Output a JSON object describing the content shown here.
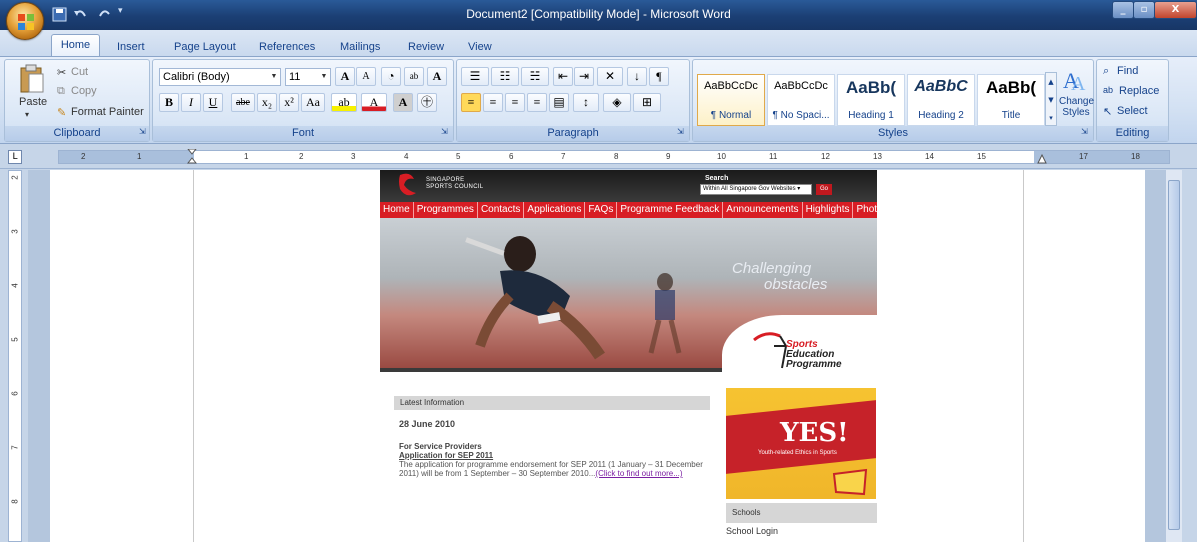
{
  "window": {
    "title": "Document2 [Compatibility Mode] - Microsoft Word",
    "close_label": "X"
  },
  "tabs": [
    "Home",
    "Insert",
    "Page Layout",
    "References",
    "Mailings",
    "Review",
    "View"
  ],
  "clipboard": {
    "paste": "Paste",
    "cut": "Cut",
    "copy": "Copy",
    "format_painter": "Format Painter",
    "label": "Clipboard"
  },
  "font": {
    "name": "Calibri (Body)",
    "size": "11",
    "bold": "B",
    "italic": "I",
    "underline": "U",
    "strikethrough": "abe",
    "subscript": "x₂",
    "superscript": "x²",
    "change_case": "Aa",
    "grow": "A",
    "shrink": "A",
    "label": "Font"
  },
  "paragraph": {
    "label": "Paragraph"
  },
  "styles": {
    "items": [
      {
        "sample": "AaBbCcDc",
        "name": "¶ Normal"
      },
      {
        "sample": "AaBbCcDc",
        "name": "¶ No Spaci..."
      },
      {
        "sample": "AaBb(",
        "name": "Heading 1"
      },
      {
        "sample": "AaBbC",
        "name": "Heading 2"
      },
      {
        "sample": "AaBb(",
        "name": "Title"
      }
    ],
    "change_styles": "Change Styles",
    "label": "Styles"
  },
  "editing": {
    "find": "Find",
    "replace": "Replace",
    "select": "Select",
    "label": "Editing"
  },
  "ruler": {
    "ticks": [
      "2",
      "1",
      "1",
      "2",
      "3",
      "4",
      "5",
      "6",
      "7",
      "8",
      "9",
      "10",
      "11",
      "12",
      "13",
      "14",
      "15",
      "17",
      "18"
    ],
    "tab_stop": "L"
  },
  "vruler": {
    "ticks": [
      "2",
      "3",
      "4",
      "5",
      "6",
      "7",
      "8"
    ]
  },
  "web": {
    "org_line1": "SINGAPORE",
    "org_line2": "SPORTS COUNCIL",
    "search_label": "Search",
    "search_scope": "Within All Singapore Gov Websites",
    "go": "Go",
    "nav": [
      "Home",
      "Programmes",
      "Contacts",
      "Applications",
      "FAQs",
      "Programme Feedback",
      "Announcements",
      "Highlights",
      "Photos"
    ],
    "hero_line1": "Challenging",
    "hero_line2": "obstacles",
    "sep_line1": "Sports",
    "sep_line2": "Education",
    "sep_line3": "Programme",
    "latest_label": "Latest Information",
    "news_date": "28 June 2010",
    "news_provider": "For Service Providers",
    "news_app": "Application for SEP 2011",
    "news_body": "The application for programme endorsement for SEP 2011 (1 January – 31 December 2011) will be from 1 September – 30 September 2010...",
    "news_more": "(Click to find out more...)",
    "yes_word": "YES!",
    "yes_tag": "Youth-related Ethics in Sports",
    "schools_label": "Schools",
    "school_login": "School Login"
  }
}
